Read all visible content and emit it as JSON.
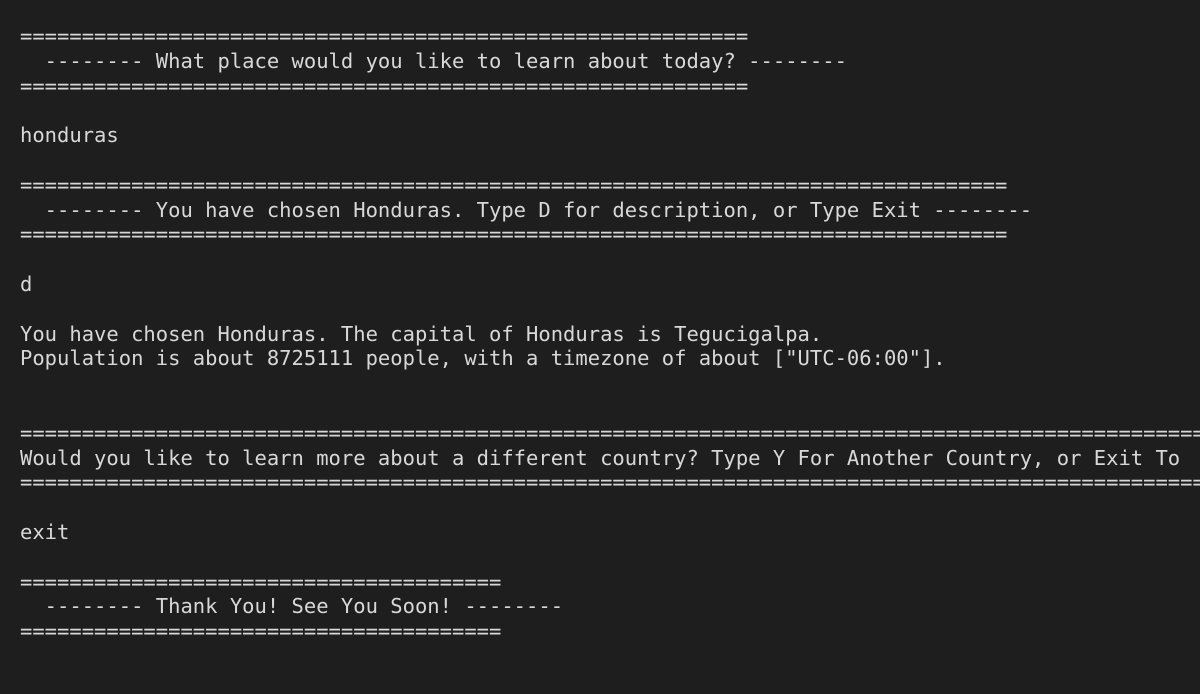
{
  "colors": {
    "background": "#1e1e1e",
    "text": "#d8d8d8"
  },
  "terminal": {
    "lines": [
      "===========================================================",
      "  -------- What place would you like to learn about today? --------",
      "===========================================================",
      "",
      "honduras",
      "",
      "================================================================================",
      "  -------- You have chosen Honduras. Type D for description, or Type Exit --------",
      "================================================================================",
      "",
      "d",
      "",
      "You have chosen Honduras. The capital of Honduras is Tegucigalpa.",
      "Population is about 8725111 people, with a timezone of about [\"UTC-06:00\"].",
      "",
      "",
      "===================================================================================================",
      "Would you like to learn more about a different country? Type Y For Another Country, or Exit To",
      "===================================================================================================",
      "",
      "exit",
      "",
      "=======================================",
      "  -------- Thank You! See You Soon! --------",
      "======================================="
    ]
  }
}
